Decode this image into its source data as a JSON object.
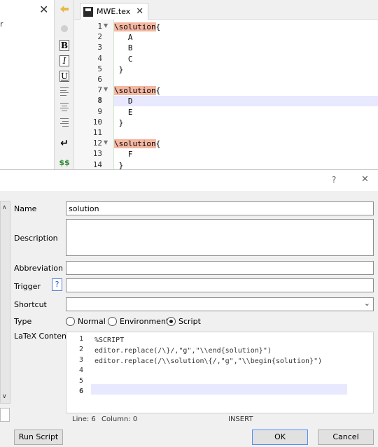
{
  "left_panel": {
    "close_glyph": "✕",
    "stub_text": "r"
  },
  "toolbar": {
    "icons": [
      "back-icon",
      "bold-icon",
      "italic-icon",
      "underline-icon",
      "align-left-icon",
      "align-center-icon",
      "align-right-icon",
      "newline-icon",
      "math-icon"
    ],
    "bold": "B",
    "italic": "I",
    "underline": "U",
    "math": "$$",
    "newline": "↵"
  },
  "tab": {
    "label": "MWE.tex",
    "close": "✕"
  },
  "editor": {
    "lines": [
      {
        "num": "1",
        "fold": true,
        "kw": "\\solution",
        "rest": "{"
      },
      {
        "num": "2",
        "text": "  A"
      },
      {
        "num": "3",
        "text": "  B"
      },
      {
        "num": "4",
        "text": "  C"
      },
      {
        "num": "5",
        "text": "}"
      },
      {
        "num": "6",
        "text": ""
      },
      {
        "num": "7",
        "fold": true,
        "kw": "\\solution",
        "rest": "{"
      },
      {
        "num": "8",
        "text": "  D",
        "current": true
      },
      {
        "num": "9",
        "text": "  E"
      },
      {
        "num": "10",
        "text": "}"
      },
      {
        "num": "11",
        "text": ""
      },
      {
        "num": "12",
        "fold": true,
        "kw": "\\solution",
        "rest": "{"
      },
      {
        "num": "13",
        "text": "  F"
      },
      {
        "num": "14",
        "text": "}"
      }
    ]
  },
  "dialog": {
    "help": "?",
    "close": "✕",
    "labels": {
      "name": "Name",
      "description": "Description",
      "abbreviation": "Abbreviation",
      "trigger": "Trigger",
      "shortcut": "Shortcut",
      "type": "Type",
      "latex": "LaTeX Content"
    },
    "values": {
      "name": "solution",
      "description": "",
      "abbreviation": "",
      "trigger": "",
      "shortcut": ""
    },
    "trigger_help": "?",
    "shortcut_arrow": "⌄",
    "type_options": [
      {
        "label": "Normal",
        "selected": false
      },
      {
        "label": "Environment",
        "selected": false
      },
      {
        "label": "Script",
        "selected": true
      }
    ],
    "latex_lines": [
      {
        "num": "1",
        "text": "%SCRIPT"
      },
      {
        "num": "2",
        "text": "editor.replace(/\\}/,\"g\",\"\\\\end{solution}\")"
      },
      {
        "num": "3",
        "text": "editor.replace(/\\\\solution\\{/,\"g\",\"\\\\begin{solution}\")"
      },
      {
        "num": "4",
        "text": ""
      },
      {
        "num": "5",
        "text": ""
      },
      {
        "num": "6",
        "text": ""
      }
    ],
    "status": {
      "line": "Line: 6",
      "column": "Column: 0",
      "mode": "INSERT"
    },
    "buttons": {
      "run_script": "Run Script",
      "ok": "OK",
      "cancel": "Cancel"
    },
    "scroll_up": "∧",
    "scroll_down": "∨"
  }
}
